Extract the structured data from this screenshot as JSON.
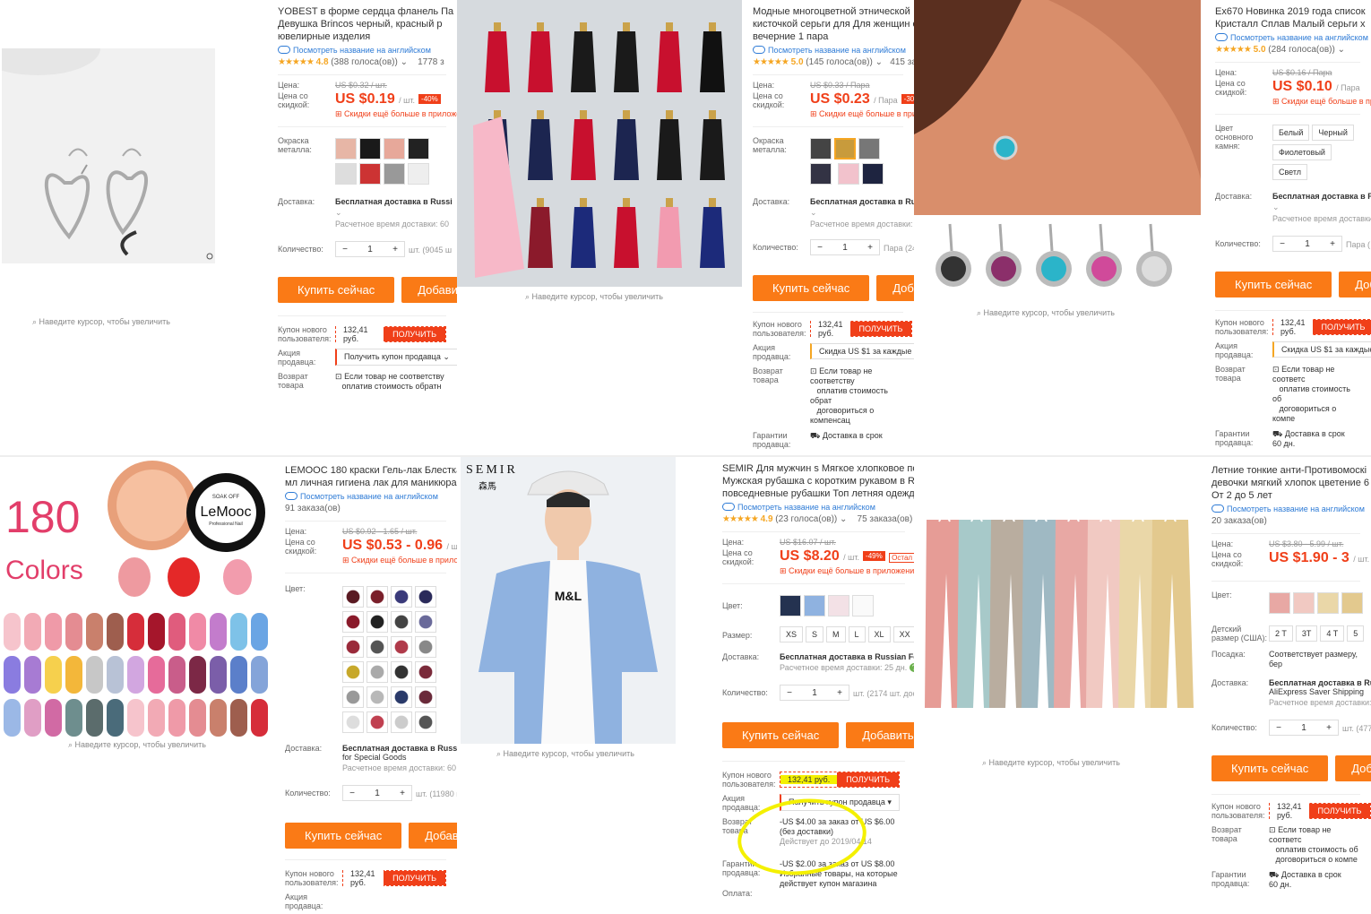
{
  "common": {
    "zoom_hint": "Наведите курсор, чтобы увеличить",
    "english_link": "Посмотреть название на английском",
    "price_lbl": "Цена:",
    "discount_lbl": "Цена со скидкой:",
    "app_promo": "Скидки ещё больше в приложении",
    "ship_lbl": "Доставка:",
    "qty_lbl": "Количество:",
    "buy": "Купить сейчас",
    "add": "Добавить в корзину",
    "coupon_lbl": "Купон нового пользователя:",
    "coupon_val": "132,41 руб.",
    "coupon_get": "ПОЛУЧИТЬ",
    "seller_lbl": "Акция продавца:",
    "return_lbl": "Возврат товара",
    "guarantee_lbl": "Гарантии продавца:",
    "return_text": "Если товар не соответствует описанию, Вы можете вернуть его или оставить себе, а продавец компенсирует стоимость",
    "ontime": "Доставка в срок",
    "days60": "60 дн."
  },
  "p1": {
    "title": [
      "YOBEST в форме сердца фланель Па",
      "Девушка Brincos черный, красный р",
      "ювелирные изделия"
    ],
    "rating": "4.8",
    "votes": "(388 голоса(ов))",
    "orders": "1778 з",
    "old": "US $0.32 / шт.",
    "price": "US $0.19",
    "unit": "/ шт.",
    "disc": "-40%",
    "opt_lbl": "Окраска металла:",
    "ship": "Бесплатная доставка в Russi",
    "ship_time": "Расчетное время доставки: 60",
    "qty": "1",
    "stock": "шт. (9045 ш",
    "seller_btn": "Получить купон продавца",
    "ret1": "Если товар не соответству",
    "ret2": "оплатив стоимость обратн"
  },
  "p2": {
    "title": [
      "Модные многоцветной этнической",
      "кисточкой серьги для Для женщин о",
      "вечерние 1 пара"
    ],
    "rating": "5.0",
    "votes": "(145 голоса(ов))",
    "orders": "415 за",
    "old": "US $0.33 / Пара",
    "price": "US $0.23",
    "unit": "/ Пара",
    "disc": "-30%",
    "opt_lbl": "Окраска металла:",
    "ship": "Бесплатная доставка в Russ",
    "ship_time": "Расчетное время доставки: 6",
    "qty": "1",
    "stock": "Пара (2424",
    "seller_btn": "Скидка US $1 за каждые US",
    "ret1": "Если товар не соответству",
    "ret2": "оплатив стоимость обрат",
    "ret3": "договориться о компенсац"
  },
  "p3": {
    "title": [
      "Ex670 Новинка 2019 года список",
      "Кристалл Сплав Малый серьги х"
    ],
    "rating": "5.0",
    "votes": "(284 голоса(ов))",
    "old": "US $0.16 / Пара",
    "price": "US $0.10",
    "unit": "/ Пара",
    "opt_lbl": "Цвет основного камня:",
    "colors": [
      "Белый",
      "Черный",
      "Фиолетовый",
      "Светл"
    ],
    "ship": "Бесплатная доставка в F",
    "ship_time": "Расчетное время доставки",
    "qty": "1",
    "stock": "Пара (",
    "seller_btn": "Скидка US $1 за каждые",
    "ret1": "Если товар не соответс",
    "ret2": "оплатив стоимость об",
    "ret3": "договориться о компе"
  },
  "p4": {
    "big_text": [
      "180",
      "Colors"
    ],
    "brand": "LeMooc",
    "jar_small": "SOAK OFF",
    "jar_pro": "Professional Nail",
    "title": [
      "LEMOOC 180 краски Гель-лак Блестками",
      "мл личная гигиена лак для маникюра"
    ],
    "orders": "91 заказа(ов)",
    "old": "US $0.92 - 1.65 / шт.",
    "price": "US $0.53 - 0.96",
    "unit": "/ шт.",
    "opt_lbl": "Цвет:",
    "ship": "Бесплатная доставка в Russian I",
    "ship2": "for Special Goods",
    "ship_time": "Расчетное время доставки: 60 дн",
    "qty": "1",
    "stock": "шт. (11980 шт."
  },
  "p5": {
    "brand": "SEMIR",
    "brand_cn": "森馬",
    "shirt_print": "M&L",
    "title": [
      "SEMIR Для мужчин s Мягкое хлопковое пол",
      "Мужская рубашка с коротким рукавом в Re",
      "повседневные рубашки Топ летняя одежд"
    ],
    "rating": "4.9",
    "votes": "(23 голоса(ов))",
    "orders": "75 заказа(ов)",
    "old": "US $16.07 / шт.",
    "price": "US $8.20",
    "unit": "/ шт.",
    "disc": "-49%",
    "left": "Остал",
    "opt_lbl": "Цвет:",
    "size_lbl": "Размер:",
    "sizes": [
      "XS",
      "S",
      "M",
      "L",
      "XL",
      "XX"
    ],
    "ship": "Бесплатная доставка в Russian Fede",
    "ship_time": "Расчетное время доставки: 25 дн.",
    "qty": "1",
    "stock": "шт. (2174 шт. досту",
    "pay_lbl": "Оплата:",
    "seller_btn": "Получить купон продавца",
    "c1": "-US $4.00 за заказ от US $6.00",
    "c1b": "(без доставки)",
    "c1c": "Действует до 2019/04/14",
    "c2": "-US $2.00 за заказ от US $8.00",
    "c2b": "Избранные товары, на которые",
    "c2c": "действует купон магазина"
  },
  "p6": {
    "title": [
      "Летние тонкие анти-Противомоскі",
      "девочки мягкий хлопок цветение 6",
      "От 2 до 5 лет"
    ],
    "orders": "20 заказа(ов)",
    "old": "US $3.80 - 5.99 / шт.",
    "price": "US $1.90 - 3",
    "unit": "/ шт.",
    "opt_lbl": "Цвет:",
    "size_lbl": "Детский размер (США):",
    "sizes": [
      "2 T",
      "3T",
      "4 T",
      "5"
    ],
    "fit_lbl": "Посадка:",
    "fit": "Соответствует размеру, бер",
    "ship": "Бесплатная доставка в Ru",
    "ship2": "AliExpress Saver Shipping",
    "ship_time": "Расчетное время доставки:",
    "qty": "1",
    "stock": "шт. (4777"
  },
  "colors": {
    "accent": "#fa7a16",
    "red": "#f03f19",
    "link": "#2e7bd6",
    "star": "#f5a623",
    "highlight": "#f4f000"
  }
}
